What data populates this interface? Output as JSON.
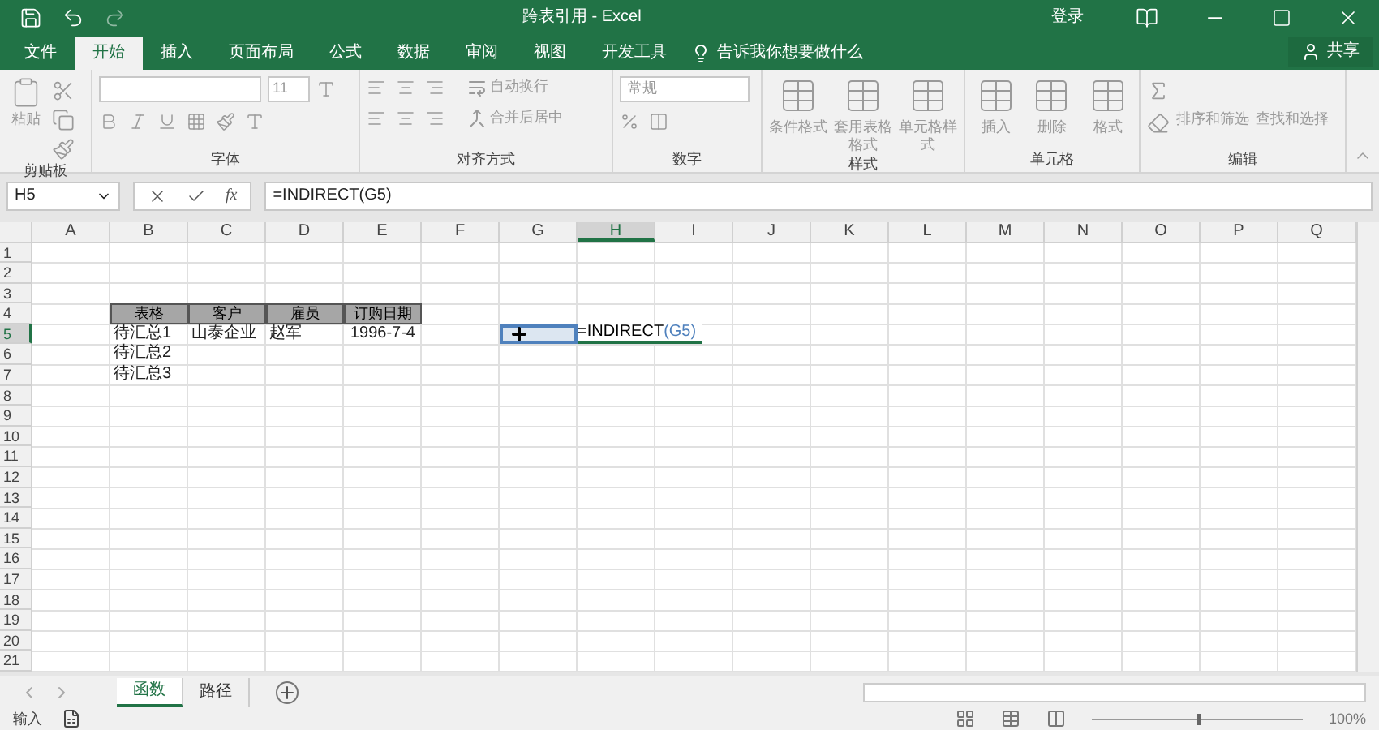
{
  "window": {
    "title": "跨表引用 - Excel",
    "sign_in": "登录",
    "share": "共享"
  },
  "menu_tabs": [
    {
      "label": "文件",
      "selected": false
    },
    {
      "label": "开始",
      "selected": true
    },
    {
      "label": "插入",
      "selected": false
    },
    {
      "label": "页面布局",
      "selected": false
    },
    {
      "label": "公式",
      "selected": false
    },
    {
      "label": "数据",
      "selected": false
    },
    {
      "label": "审阅",
      "selected": false
    },
    {
      "label": "视图",
      "selected": false
    },
    {
      "label": "开发工具",
      "selected": false
    }
  ],
  "tell_me": "告诉我你想要做什么",
  "ribbon": {
    "disabled": true,
    "font_size": "11",
    "number_format": "常规",
    "groups": [
      {
        "label": "剪贴板",
        "buttons": [
          {
            "label": "粘贴"
          }
        ]
      },
      {
        "label": "字体"
      },
      {
        "label": "对齐方式",
        "buttons": [
          {
            "label": "自动换行"
          },
          {
            "label": "合并后居中"
          }
        ]
      },
      {
        "label": "数字"
      },
      {
        "label": "样式",
        "buttons": [
          {
            "label": "条件格式"
          },
          {
            "label": "套用表格格式"
          },
          {
            "label": "单元格样式"
          }
        ]
      },
      {
        "label": "单元格",
        "buttons": [
          {
            "label": "插入"
          },
          {
            "label": "删除"
          },
          {
            "label": "格式"
          }
        ]
      },
      {
        "label": "编辑",
        "buttons": [
          {
            "label": "排序和筛选"
          },
          {
            "label": "查找和选择"
          }
        ]
      }
    ]
  },
  "name_box": "H5",
  "function_label": "fx",
  "formula": "=INDIRECT(G5)",
  "columns": [
    {
      "label": "A",
      "selected": false
    },
    {
      "label": "B",
      "selected": false
    },
    {
      "label": "C",
      "selected": false
    },
    {
      "label": "D",
      "selected": false
    },
    {
      "label": "E",
      "selected": false
    },
    {
      "label": "F",
      "selected": false
    },
    {
      "label": "G",
      "selected": false
    },
    {
      "label": "H",
      "selected": true
    },
    {
      "label": "I",
      "selected": false
    },
    {
      "label": "J",
      "selected": false
    },
    {
      "label": "K",
      "selected": false
    },
    {
      "label": "L",
      "selected": false
    },
    {
      "label": "M",
      "selected": false
    },
    {
      "label": "N",
      "selected": false
    },
    {
      "label": "O",
      "selected": false
    },
    {
      "label": "P",
      "selected": false
    },
    {
      "label": "Q",
      "selected": false
    }
  ],
  "rows": [
    {
      "label": "1",
      "selected": false
    },
    {
      "label": "2",
      "selected": false
    },
    {
      "label": "3",
      "selected": false
    },
    {
      "label": "4",
      "selected": false
    },
    {
      "label": "5",
      "selected": true
    },
    {
      "label": "6",
      "selected": false
    },
    {
      "label": "7",
      "selected": false
    },
    {
      "label": "8",
      "selected": false
    },
    {
      "label": "9",
      "selected": false
    },
    {
      "label": "10",
      "selected": false
    },
    {
      "label": "11",
      "selected": false
    },
    {
      "label": "12",
      "selected": false
    },
    {
      "label": "13",
      "selected": false
    },
    {
      "label": "14",
      "selected": false
    },
    {
      "label": "15",
      "selected": false
    },
    {
      "label": "16",
      "selected": false
    },
    {
      "label": "17",
      "selected": false
    },
    {
      "label": "18",
      "selected": false
    },
    {
      "label": "19",
      "selected": false
    },
    {
      "label": "20",
      "selected": false
    },
    {
      "label": "21",
      "selected": false
    }
  ],
  "data_table": {
    "columns": [
      "表格",
      "客户",
      "雇员",
      "订购日期"
    ],
    "rows": [
      [
        "待汇总1",
        "山泰企业",
        "赵军",
        "1996-7-4"
      ],
      [
        "待汇总2"
      ],
      [
        "待汇总3"
      ]
    ]
  },
  "cell_edit": [
    {
      "text": "=INDIRECT",
      "kind": "plain"
    },
    {
      "text": "(G5)",
      "kind": "reference"
    }
  ],
  "sheet_tabs": [
    {
      "label": "函数",
      "selected": true
    },
    {
      "label": "路径",
      "selected": false
    }
  ],
  "status_bar": {
    "mode": "输入",
    "zoom": "100%",
    "zoom_slider": {
      "level": 0.5
    }
  }
}
